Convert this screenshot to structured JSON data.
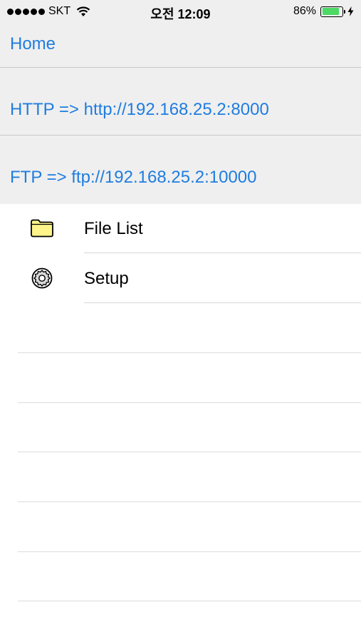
{
  "status_bar": {
    "carrier": "SKT",
    "time": "오전 12:09",
    "battery_percent": "86%",
    "battery_level": 0.86,
    "battery_color": "#4cd964",
    "icons": [
      "signal-dots-icon",
      "wifi-icon",
      "battery-icon",
      "charging-bolt-icon"
    ]
  },
  "nav": {
    "home_label": "Home"
  },
  "server_info": {
    "http": "HTTP => http://192.168.25.2:8000",
    "ftp": "FTP => ftp://192.168.25.2:10000"
  },
  "menu": {
    "items": [
      {
        "label": "File List",
        "icon": "folder-icon"
      },
      {
        "label": "Setup",
        "icon": "gear-icon"
      }
    ]
  },
  "colors": {
    "accent": "#1f7de0",
    "header_bg": "#efefef",
    "folder_fill": "#fff48a"
  }
}
